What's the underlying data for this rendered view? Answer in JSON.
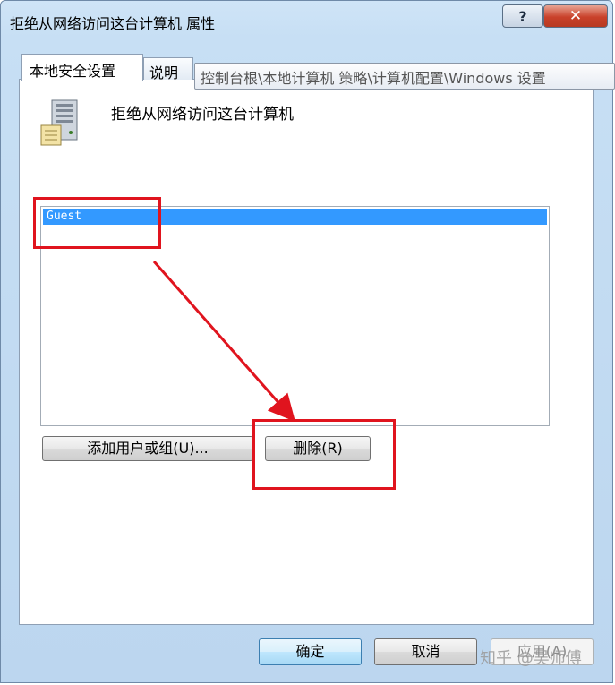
{
  "window": {
    "title": "拒绝从网络访问这台计算机 属性",
    "help_glyph": "?",
    "close_glyph": "✕"
  },
  "tabs": [
    {
      "label": "本地安全设置"
    },
    {
      "label": "说明"
    }
  ],
  "tooltip": "控制台根\\本地计算机 策略\\计算机配置\\Windows 设置",
  "policy": {
    "icon": "server-computer-icon",
    "name": "拒绝从网络访问这台计算机"
  },
  "list": {
    "items": [
      "Guest"
    ]
  },
  "buttons": {
    "add": "添加用户或组(U)...",
    "remove": "删除(R)",
    "ok": "确定",
    "cancel": "取消",
    "apply": "应用(A)"
  },
  "annotation_color": "#e0141e",
  "watermark": "知乎 @吴师傅"
}
